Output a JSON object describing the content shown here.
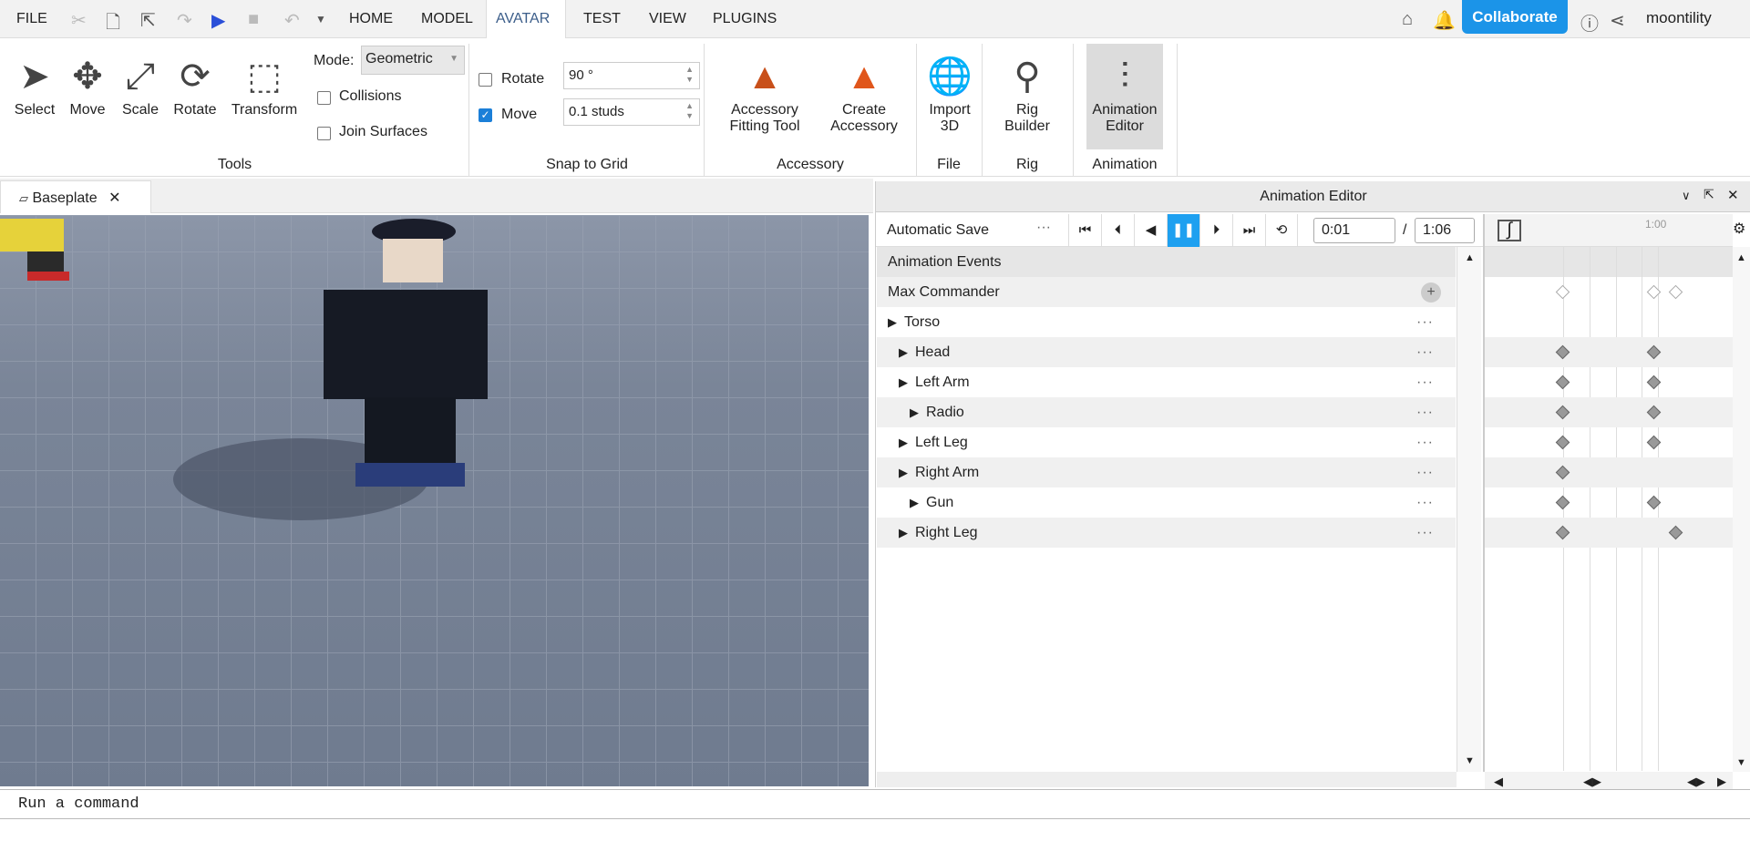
{
  "menubar": {
    "file": "FILE",
    "tabs": [
      "HOME",
      "MODEL",
      "AVATAR",
      "TEST",
      "VIEW",
      "PLUGINS"
    ],
    "active_tab": "AVATAR",
    "collaborate": "Collaborate",
    "user": "moontility",
    "accent": "#1b94e8"
  },
  "ribbon": {
    "tools": [
      "Select",
      "Move",
      "Scale",
      "Rotate",
      "Transform"
    ],
    "mode_label": "Mode:",
    "mode_value": "Geometric",
    "collisions": "Collisions",
    "join_surfaces": "Join Surfaces",
    "tools_group": "Tools",
    "snap": {
      "rotate_label": "Rotate",
      "rotate_value": "90 °",
      "rotate_checked": false,
      "move_label": "Move",
      "move_value": "0.1 studs",
      "move_checked": true,
      "group": "Snap to Grid"
    },
    "accessory": {
      "fitting_1": "Accessory",
      "fitting_2": "Fitting Tool",
      "create_1": "Create",
      "create_2": "Accessory",
      "group": "Accessory"
    },
    "file": {
      "l1": "Import",
      "l2": "3D",
      "group": "File"
    },
    "rig": {
      "l1": "Rig",
      "l2": "Builder",
      "group": "Rig"
    },
    "animation": {
      "l1": "Animation",
      "l2": "Editor",
      "group": "Animation"
    }
  },
  "doc_tab": "Baseplate",
  "anim_editor": {
    "title": "Animation Editor",
    "save": "Automatic Save",
    "current_time": "0:01",
    "slash": "/",
    "total_time": "1:06",
    "tick_label": "1:00",
    "events": "Animation Events",
    "rig_name": "Max Commander",
    "tracks": [
      {
        "name": "Torso",
        "indent": 0
      },
      {
        "name": "Head",
        "indent": 1
      },
      {
        "name": "Left Arm",
        "indent": 1
      },
      {
        "name": "Radio",
        "indent": 2
      },
      {
        "name": "Left Leg",
        "indent": 1
      },
      {
        "name": "Right Arm",
        "indent": 1
      },
      {
        "name": "Gun",
        "indent": 2
      },
      {
        "name": "Right Leg",
        "indent": 1
      }
    ]
  },
  "command": {
    "placeholder": "Run a command"
  }
}
